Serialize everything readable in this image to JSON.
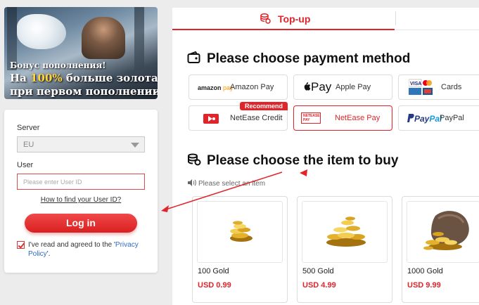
{
  "banner": {
    "line1": "Бонус пополнения!",
    "line2_pre": "На ",
    "line2_highlight": "100%",
    "line2_post": " больше золота",
    "line3": "при первом пополнении"
  },
  "login": {
    "server_label": "Server",
    "server_value": "EU",
    "user_label": "User",
    "user_placeholder": "Please enter User ID",
    "howto_link": "How to find your User ID?",
    "login_button": "Log in",
    "agree_prefix": "I've read and agreed to the '",
    "agree_link": "Privacy Policy",
    "agree_suffix": "'."
  },
  "tabs": {
    "active": "Top-up"
  },
  "payment": {
    "heading": "Please choose payment method",
    "methods": [
      {
        "logo": "amazon pay",
        "name": "Amazon Pay"
      },
      {
        "logo": "Pay",
        "name": "Apple Pay"
      },
      {
        "logo": "cards",
        "name": "Cards"
      },
      {
        "logo": "netease",
        "name": "NetEase Credit",
        "badge": "Recommend"
      },
      {
        "logo": "NETEASE PAY",
        "name": "NetEase Pay",
        "selected": true
      },
      {
        "logo": "PayPal",
        "name": "PayPal"
      }
    ]
  },
  "items": {
    "heading": "Please choose the item to buy",
    "hint": "Please select an item",
    "list": [
      {
        "name": "100 Gold",
        "price": "USD 0.99"
      },
      {
        "name": "500 Gold",
        "price": "USD 4.99"
      },
      {
        "name": "1000 Gold",
        "price": "USD 9.99"
      }
    ]
  },
  "colors": {
    "accent": "#e0242a",
    "link": "#2f6bc4"
  }
}
